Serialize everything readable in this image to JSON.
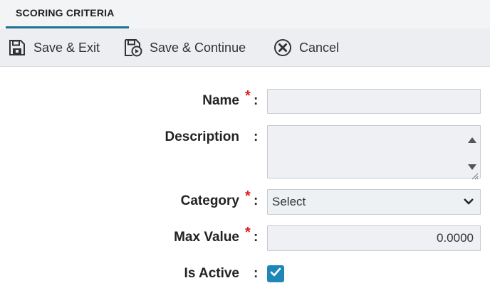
{
  "tab": {
    "label": "SCORING CRITERIA"
  },
  "toolbar": {
    "save_exit": {
      "label": "Save & Exit",
      "icon": "save-icon"
    },
    "save_continue": {
      "label": "Save & Continue",
      "icon": "save-continue-icon"
    },
    "cancel": {
      "label": "Cancel",
      "icon": "cancel-icon"
    }
  },
  "form": {
    "name": {
      "label": "Name",
      "required": true,
      "value": ""
    },
    "description": {
      "label": "Description",
      "required": false,
      "value": ""
    },
    "category": {
      "label": "Category",
      "required": true,
      "selected": "Select"
    },
    "max_value": {
      "label": "Max Value",
      "required": true,
      "value": "0.0000"
    },
    "is_active": {
      "label": "Is Active",
      "required": false,
      "checked": true
    }
  },
  "required_marker": "*",
  "colon": ":",
  "colors": {
    "accent": "#1f6f93",
    "required": "#e01c1c",
    "checkbox": "#1f87b8"
  }
}
